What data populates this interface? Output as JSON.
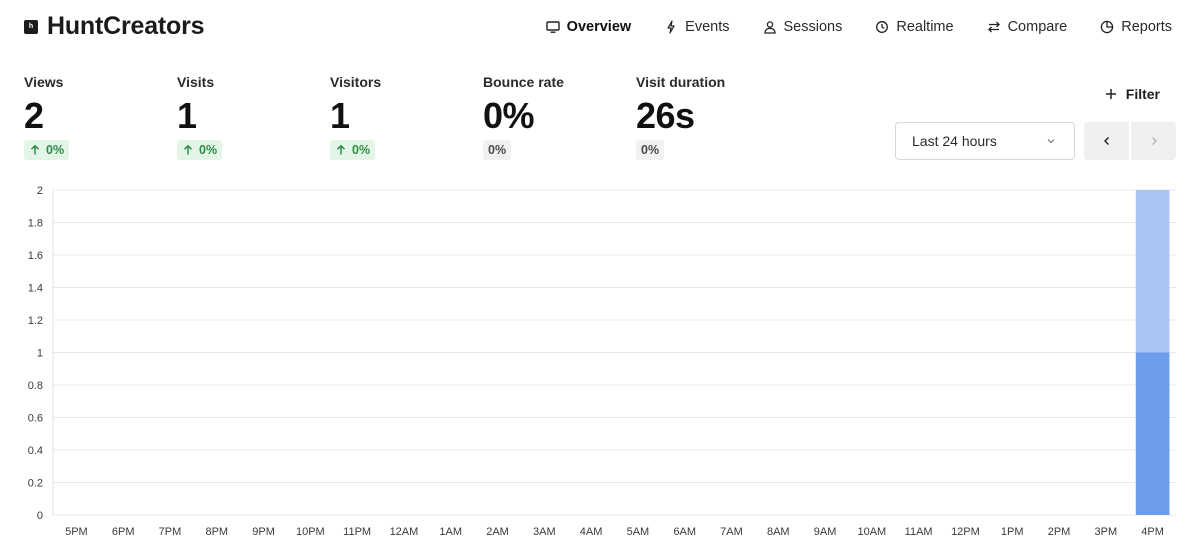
{
  "app": {
    "name": "HuntCreators",
    "logo_letter": "h"
  },
  "nav": {
    "items": [
      {
        "label": "Overview",
        "icon": "monitor-icon",
        "active": true
      },
      {
        "label": "Events",
        "icon": "lightning-icon",
        "active": false
      },
      {
        "label": "Sessions",
        "icon": "user-icon",
        "active": false
      },
      {
        "label": "Realtime",
        "icon": "clock-icon",
        "active": false
      },
      {
        "label": "Compare",
        "icon": "swap-icon",
        "active": false
      },
      {
        "label": "Reports",
        "icon": "pie-icon",
        "active": false
      }
    ]
  },
  "metrics": [
    {
      "label": "Views",
      "value": "2",
      "change": "0%",
      "trend": "up"
    },
    {
      "label": "Visits",
      "value": "1",
      "change": "0%",
      "trend": "up"
    },
    {
      "label": "Visitors",
      "value": "1",
      "change": "0%",
      "trend": "up"
    },
    {
      "label": "Bounce rate",
      "value": "0%",
      "change": "0%",
      "trend": "neutral"
    },
    {
      "label": "Visit duration",
      "value": "26s",
      "change": "0%",
      "trend": "neutral"
    }
  ],
  "controls": {
    "filter_label": "Filter",
    "range_value": "Last 24 hours"
  },
  "colors": {
    "views": "#aac4f3",
    "visitors": "#6d9ceb",
    "positive": "#2e8b48",
    "grid": "#e8e8e8"
  },
  "chart_data": {
    "type": "bar",
    "stacked": true,
    "categories": [
      "5PM",
      "6PM",
      "7PM",
      "8PM",
      "9PM",
      "10PM",
      "11PM",
      "12AM",
      "1AM",
      "2AM",
      "3AM",
      "4AM",
      "5AM",
      "6AM",
      "7AM",
      "8AM",
      "9AM",
      "10AM",
      "11AM",
      "12PM",
      "1PM",
      "2PM",
      "3PM",
      "4PM"
    ],
    "series": [
      {
        "values": [
          0,
          0,
          0,
          0,
          0,
          0,
          0,
          0,
          0,
          0,
          0,
          0,
          0,
          0,
          0,
          0,
          0,
          0,
          0,
          0,
          0,
          0,
          0,
          1
        ],
        "color": "#6d9ceb"
      },
      {
        "values": [
          0,
          0,
          0,
          0,
          0,
          0,
          0,
          0,
          0,
          0,
          0,
          0,
          0,
          0,
          0,
          0,
          0,
          0,
          0,
          0,
          0,
          0,
          0,
          1
        ],
        "color": "#aac4f3"
      }
    ],
    "y_ticks": [
      "0",
      "0.2",
      "0.4",
      "0.6",
      "0.8",
      "1",
      "1.2",
      "1.4",
      "1.6",
      "1.8",
      "2"
    ],
    "ylim": [
      0,
      2
    ],
    "grid": true,
    "legend": "none",
    "title": "",
    "xlabel": "",
    "ylabel": ""
  }
}
